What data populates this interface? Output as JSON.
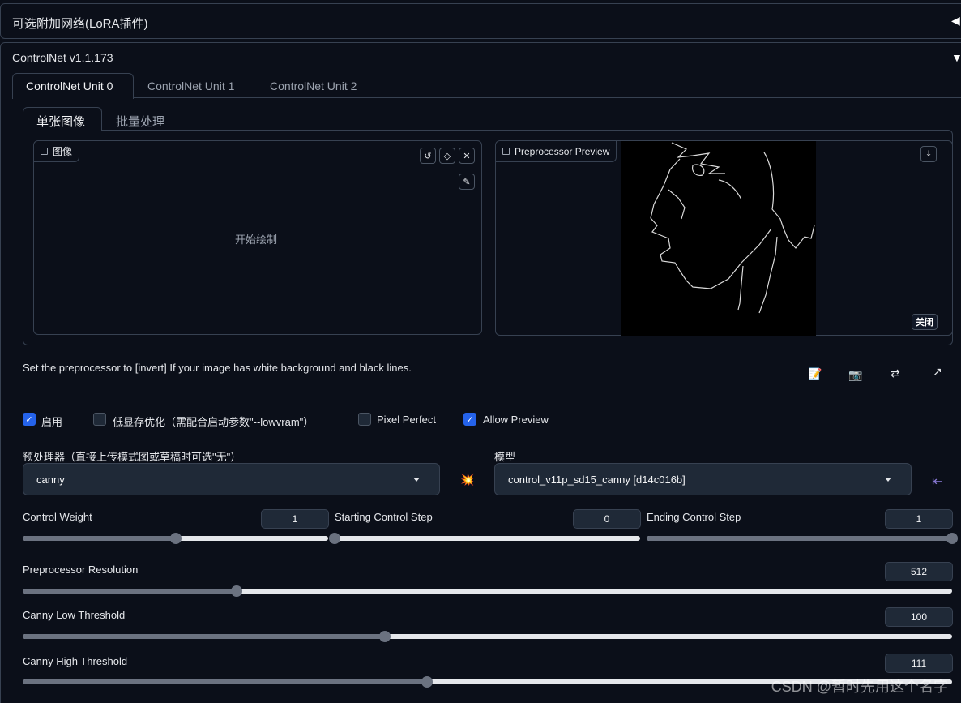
{
  "lora_panel": {
    "title": "可选附加网络(LoRA插件)"
  },
  "controlnet": {
    "title": "ControlNet v1.1.173",
    "unit_tabs": [
      "ControlNet Unit 0",
      "ControlNet Unit 1",
      "ControlNet Unit 2"
    ],
    "mode_tabs": [
      "单张图像",
      "批量处理"
    ],
    "image_box": {
      "label": "图像",
      "placeholder": "开始绘制"
    },
    "preview_box": {
      "label": "Preprocessor Preview",
      "close_label": "关闭"
    },
    "hint": "Set the preprocessor to [invert] If your image has white background and black lines.",
    "checkboxes": {
      "enable": {
        "label": "启用",
        "checked": true
      },
      "lowvram": {
        "label": "低显存优化（需配合启动参数\"--lowvram\"）",
        "checked": false
      },
      "pixel_perfect": {
        "label": "Pixel Perfect",
        "checked": false
      },
      "allow_preview": {
        "label": "Allow Preview",
        "checked": true
      }
    },
    "preprocessor": {
      "label": "预处理器（直接上传模式图或草稿时可选\"无\"）",
      "value": "canny"
    },
    "model": {
      "label": "模型",
      "value": "control_v11p_sd15_canny [d14c016b]"
    },
    "sliders": {
      "control_weight": {
        "label": "Control Weight",
        "value": "1",
        "fraction": 0.5
      },
      "starting_step": {
        "label": "Starting Control Step",
        "value": "0",
        "fraction": 0.0
      },
      "ending_step": {
        "label": "Ending Control Step",
        "value": "1",
        "fraction": 1.0
      },
      "preprocessor_resolution": {
        "label": "Preprocessor Resolution",
        "value": "512",
        "fraction": 0.23
      },
      "canny_low": {
        "label": "Canny Low Threshold",
        "value": "100",
        "fraction": 0.39
      },
      "canny_high": {
        "label": "Canny High Threshold",
        "value": "111",
        "fraction": 0.435
      }
    },
    "colors": {
      "accent": "#2563eb",
      "background": "#0b0f19",
      "surface": "#1f2937",
      "border": "#374151"
    }
  },
  "watermark": "CSDN @暂时先用这个名字"
}
